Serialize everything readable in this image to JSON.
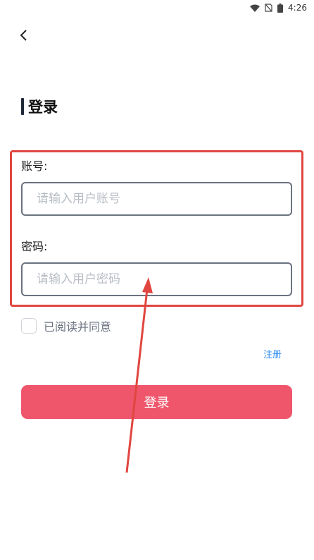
{
  "status_bar": {
    "time": "4:26"
  },
  "page": {
    "title": "登录"
  },
  "form": {
    "account_label": "账号:",
    "account_placeholder": "请输入用户账号",
    "password_label": "密码:",
    "password_placeholder": "请输入用户密码"
  },
  "agreement": {
    "text": "已阅读并同意",
    "checked": false
  },
  "links": {
    "register": "注册"
  },
  "actions": {
    "login": "登录"
  },
  "colors": {
    "primary_button": "#ef566c",
    "link": "#2d8cf0",
    "highlight_annotation": "#e0463f"
  }
}
